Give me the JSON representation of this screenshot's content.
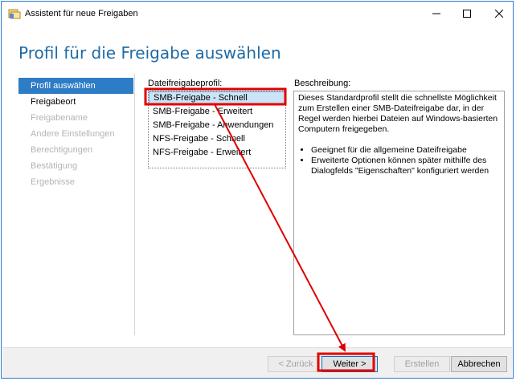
{
  "window": {
    "title": "Assistent für neue Freigaben",
    "controls": {
      "minimize": "—",
      "maximize": "☐",
      "close": "✕"
    }
  },
  "header": {
    "title": "Profil für die Freigabe auswählen"
  },
  "steps": [
    {
      "label": "Profil auswählen",
      "state": "active"
    },
    {
      "label": "Freigabeort",
      "state": "enabled"
    },
    {
      "label": "Freigabename",
      "state": "disabled"
    },
    {
      "label": "Andere Einstellungen",
      "state": "disabled"
    },
    {
      "label": "Berechtigungen",
      "state": "disabled"
    },
    {
      "label": "Bestätigung",
      "state": "disabled"
    },
    {
      "label": "Ergebnisse",
      "state": "disabled"
    }
  ],
  "profile": {
    "label": "Dateifreigabeprofil:",
    "items": [
      "SMB-Freigabe - Schnell",
      "SMB-Freigabe - Erweitert",
      "SMB-Freigabe - Anwendungen",
      "NFS-Freigabe - Schnell",
      "NFS-Freigabe - Erweitert"
    ],
    "selected": "SMB-Freigabe - Schnell"
  },
  "description": {
    "label": "Beschreibung:",
    "paragraph": "Dieses Standardprofil stellt die schnellste Möglichkeit zum Erstellen einer SMB-Dateifreigabe dar, in der Regel werden hierbei Dateien auf Windows-basierten Computern freigegeben.",
    "bullets": [
      "Geeignet für die allgemeine Dateifreigabe",
      "Erweiterte Optionen können später mithilfe des Dialogfelds \"Eigenschaften\" konfiguriert werden"
    ]
  },
  "buttons": {
    "back": "< Zurück",
    "next": "Weiter >",
    "create": "Erstellen",
    "cancel": "Abbrechen"
  },
  "annotation_color": "#e00000",
  "accent_color": "#2d7cc6"
}
